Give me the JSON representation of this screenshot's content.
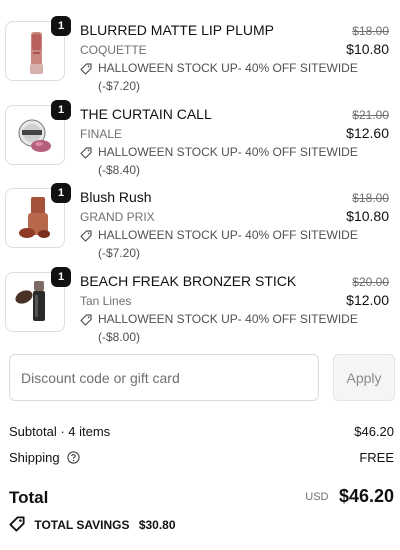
{
  "items": [
    {
      "name": "BLURRED MATTE LIP PLUMP",
      "variant": "COQUETTE",
      "quantity": "1",
      "discount_label": "HALLOWEEN STOCK UP- 40% OFF SITEWIDE",
      "discount_amount": "(-$7.20)",
      "original_price": "$18.00",
      "price": "$10.80",
      "product_color": "#b8615d"
    },
    {
      "name": "THE CURTAIN CALL",
      "variant": "FINALE",
      "quantity": "1",
      "discount_label": "HALLOWEEN STOCK UP- 40% OFF SITEWIDE",
      "discount_amount": "(-$8.40)",
      "original_price": "$21.00",
      "price": "$12.60",
      "product_color": "#b4607a"
    },
    {
      "name": "Blush Rush",
      "variant": "GRAND PRIX",
      "quantity": "1",
      "discount_label": "HALLOWEEN STOCK UP- 40% OFF SITEWIDE",
      "discount_amount": "(-$7.20)",
      "original_price": "$18.00",
      "price": "$10.80",
      "product_color": "#8e3a25"
    },
    {
      "name": "BEACH FREAK BRONZER STICK",
      "variant": "Tan Lines",
      "quantity": "1",
      "discount_label": "HALLOWEEN STOCK UP- 40% OFF SITEWIDE",
      "discount_amount": "(-$8.00)",
      "original_price": "$20.00",
      "price": "$12.00",
      "product_color": "#4a3128"
    }
  ],
  "discount_field": {
    "placeholder": "Discount code or gift card",
    "value": "",
    "apply_label": "Apply"
  },
  "summary": {
    "subtotal_label": "Subtotal · 4 items",
    "subtotal_value": "$46.20",
    "shipping_label": "Shipping",
    "shipping_value": "FREE",
    "total_label": "Total",
    "currency": "USD",
    "total_value": "$46.20",
    "savings_label": "TOTAL SAVINGS",
    "savings_value": "$30.80"
  },
  "icons": {
    "discount": "tag-icon",
    "shipping_help": "question-circle-icon",
    "savings": "tag-icon"
  }
}
